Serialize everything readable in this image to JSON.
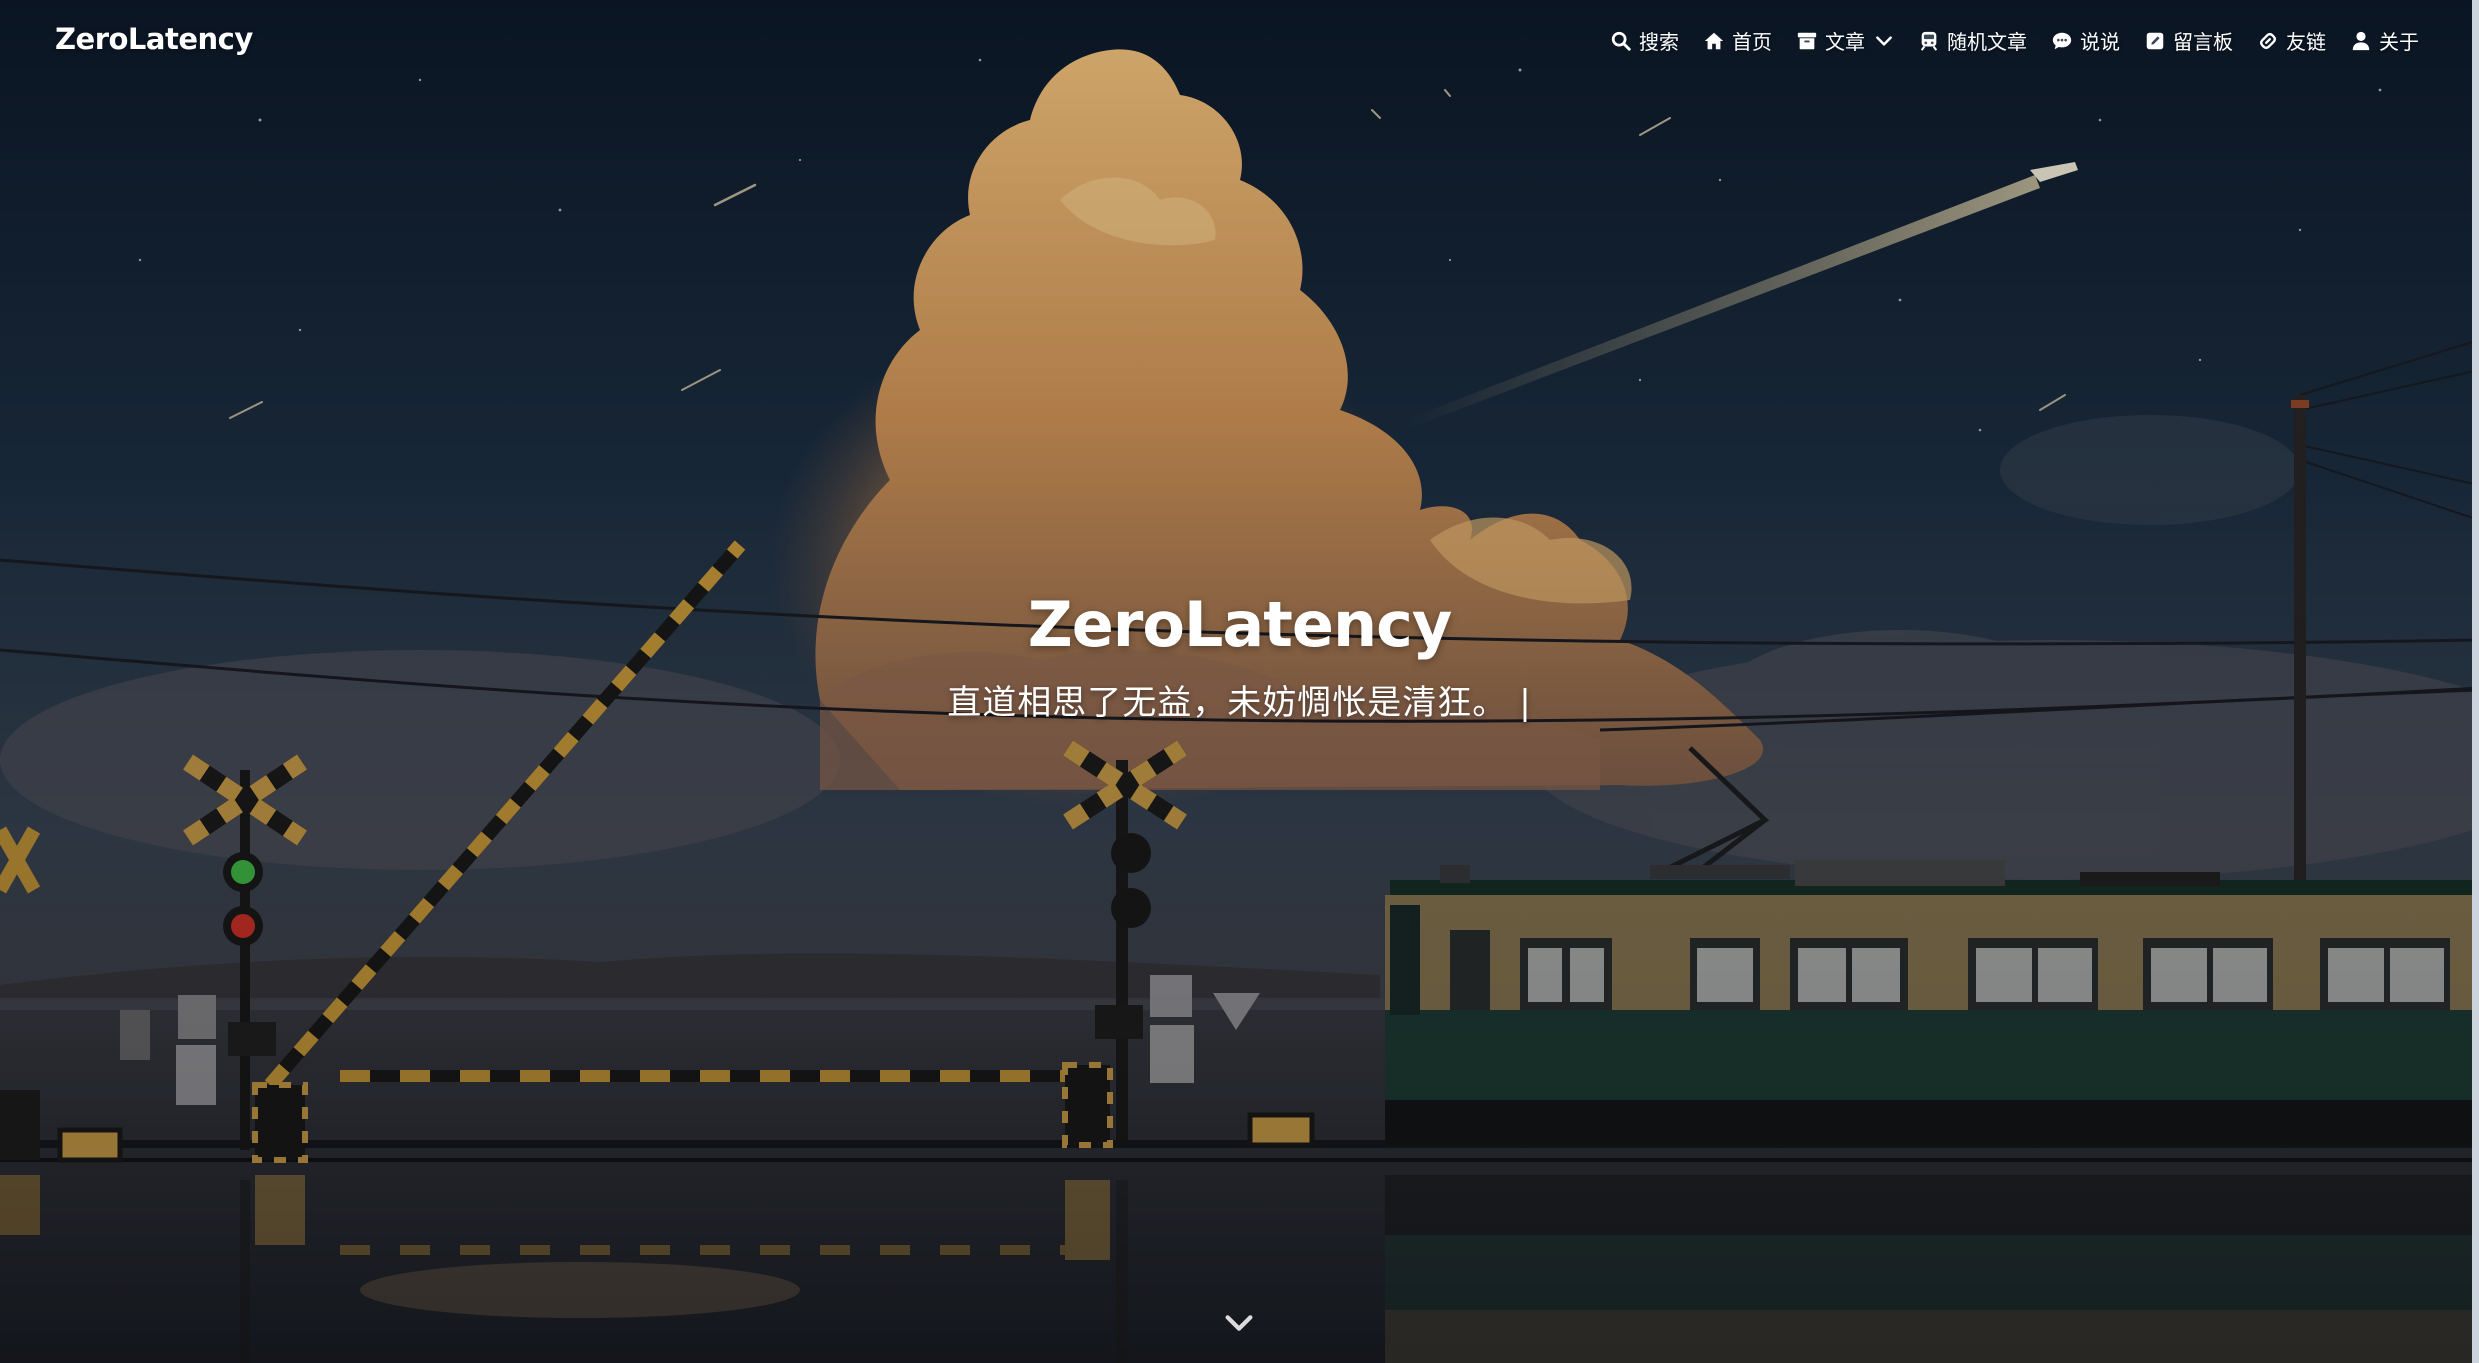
{
  "site": {
    "brand": "ZeroLatency"
  },
  "nav": {
    "items": [
      {
        "label": "搜索",
        "icon": "search-icon"
      },
      {
        "label": "首页",
        "icon": "home-icon"
      },
      {
        "label": "文章",
        "icon": "archive-icon",
        "dropdown": true
      },
      {
        "label": "随机文章",
        "icon": "train-icon"
      },
      {
        "label": "说说",
        "icon": "chat-icon"
      },
      {
        "label": "留言板",
        "icon": "edit-icon"
      },
      {
        "label": "友链",
        "icon": "link-icon"
      },
      {
        "label": "关于",
        "icon": "user-icon"
      }
    ]
  },
  "hero": {
    "title": "ZeroLatency",
    "subtitle": "直道相思了无益，未妨惆怅是清狂。",
    "cursor": "|",
    "scroll_icon": "chevron-down-icon"
  },
  "colors": {
    "sky_top": "#0d1a2b",
    "sky_mid": "#2b4257",
    "cloud_glow": "#e7a459",
    "train_body": "#1f3a36",
    "train_band": "#8a7a52",
    "text": "#ffffff"
  }
}
